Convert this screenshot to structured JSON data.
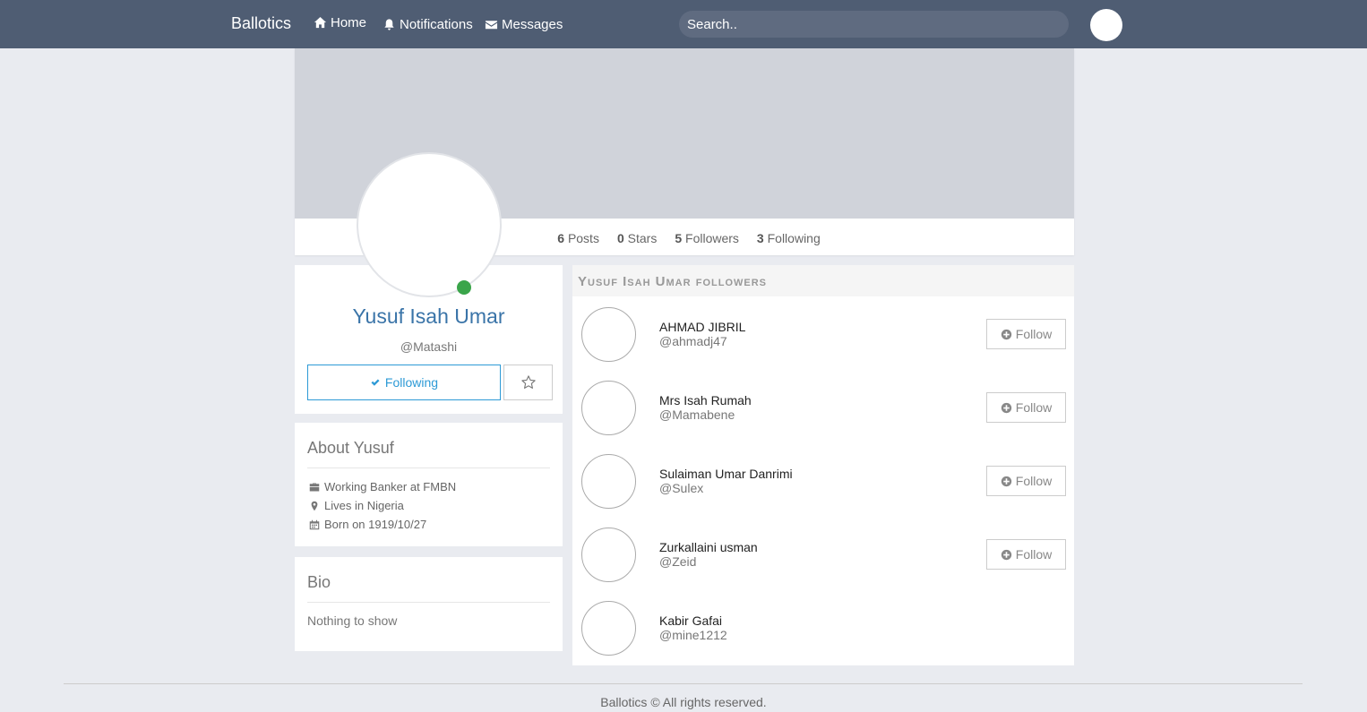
{
  "nav": {
    "brand": "Ballotics",
    "home": "Home",
    "notifications": "Notifications",
    "messages": "Messages",
    "search_placeholder": "Search.."
  },
  "stats": {
    "posts_count": "6",
    "posts_label": "Posts",
    "stars_count": "0",
    "stars_label": "Stars",
    "followers_count": "5",
    "followers_label": "Followers",
    "following_count": "3",
    "following_label": "Following"
  },
  "profile": {
    "name": "Yusuf Isah Umar",
    "handle": "@Matashi",
    "following_label": "Following",
    "online_color": "#3aa54a"
  },
  "about": {
    "title": "About Yusuf",
    "work": "Working Banker at FMBN",
    "location": "Lives in Nigeria",
    "born": "Born on 1919/10/27"
  },
  "bio": {
    "title": "Bio",
    "text": "Nothing to show"
  },
  "followers": {
    "title": "Yusuf Isah Umar followers",
    "follow_label": "Follow",
    "items": [
      {
        "name": "AHMAD JIBRIL",
        "handle": "@ahmadj47"
      },
      {
        "name": "Mrs Isah Rumah",
        "handle": "@Mamabene"
      },
      {
        "name": "Sulaiman Umar Danrimi",
        "handle": "@Sulex"
      },
      {
        "name": "Zurkallaini usman",
        "handle": "@Zeid"
      },
      {
        "name": "Kabir Gafai",
        "handle": "@mine1212"
      }
    ]
  },
  "footer": {
    "text": "Ballotics © All rights reserved."
  },
  "colors": {
    "navbar": "#4f5d73",
    "accent": "#2d9ad6",
    "name": "#3a74a8"
  }
}
